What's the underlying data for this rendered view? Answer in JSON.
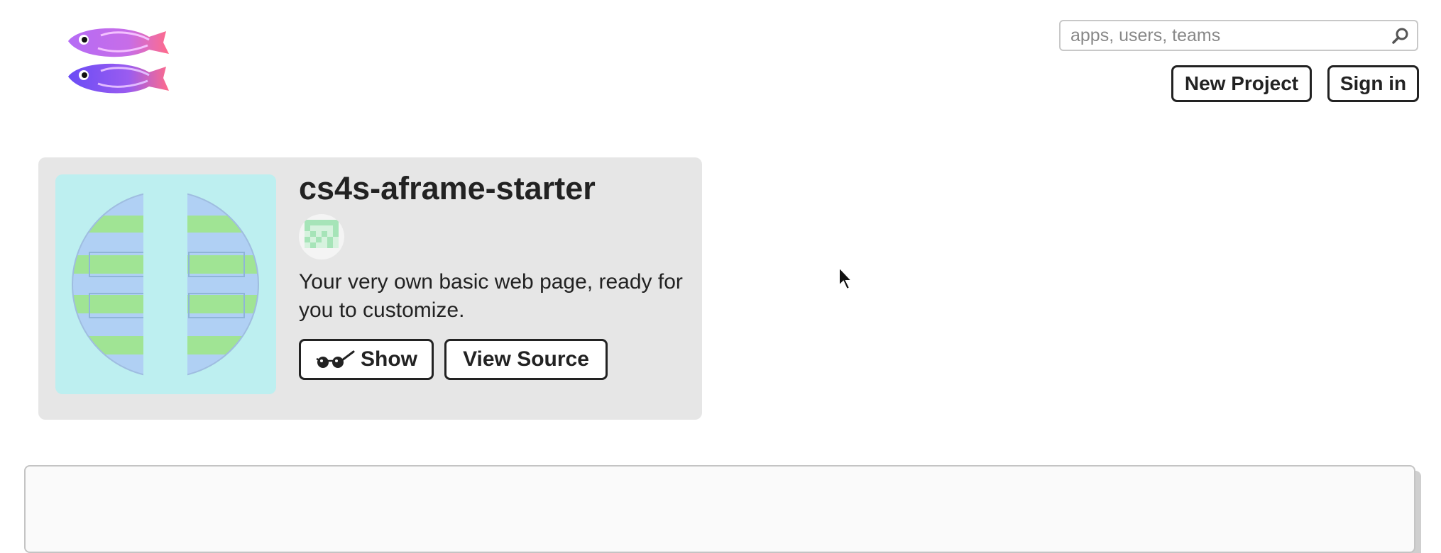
{
  "header": {
    "logo_icon": "glitch-fish-logo",
    "search": {
      "placeholder": "apps, users, teams",
      "value": "",
      "icon": "search-icon"
    },
    "new_project_label": "New Project",
    "sign_in_label": "Sign in"
  },
  "project": {
    "title": "cs4s-aframe-starter",
    "avatar_icon": "pixel-avatar",
    "description": "Your very own basic web page, ready for you to customize.",
    "show_label": "Show",
    "show_icon": "glasses-icon",
    "view_source_label": "View Source"
  },
  "colors": {
    "card_bg": "#e6e6e6",
    "thumb_bg": "#bdeff0",
    "stripe_blue": "#b0d0f4",
    "stripe_green": "#a0e494",
    "button_border": "#222222"
  }
}
